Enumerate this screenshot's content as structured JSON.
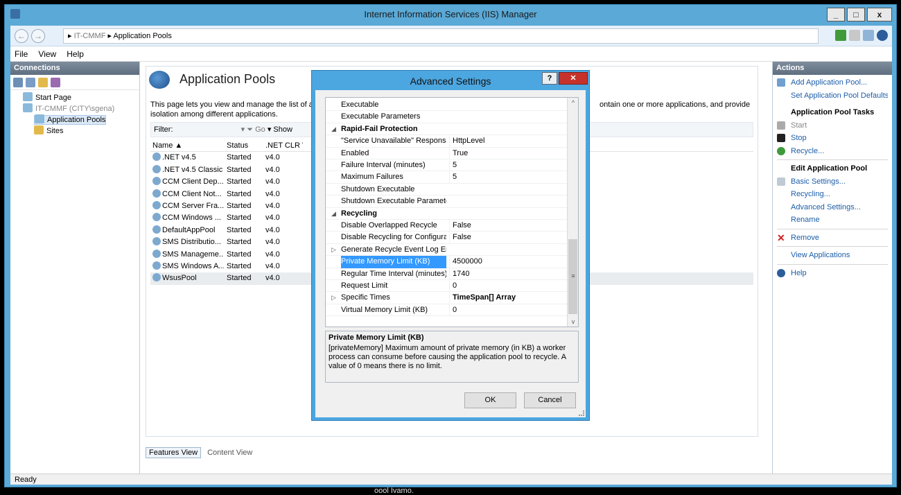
{
  "window": {
    "title": "Internet Information Services (IIS) Manager",
    "minimize": "_",
    "maximize": "□",
    "close": "x"
  },
  "address": {
    "back": "←",
    "forward": "→",
    "separator": "▸",
    "server": "IT-CMMF",
    "page": "Application Pools"
  },
  "menu": [
    "File",
    "View",
    "Help"
  ],
  "connections": {
    "header": "Connections",
    "tree": [
      {
        "label": "Start Page",
        "indent": 1
      },
      {
        "label": "IT-CMMF (CITY\\sgena)",
        "indent": 1
      },
      {
        "label": "Application Pools",
        "indent": 2,
        "selected": true
      },
      {
        "label": "Sites",
        "indent": 2
      }
    ]
  },
  "main": {
    "title": "Application Pools",
    "description": "This page lets you view and manage the list of app",
    "description2": "isolation among different applications.",
    "description_tail": "ontain one or more applications, and provide",
    "filter": {
      "label": "Filter:",
      "go": "Go",
      "show": "Show"
    },
    "columns": [
      "Name",
      "Status",
      ".NET CLR V..."
    ],
    "rows": [
      {
        "name": ".NET v4.5",
        "status": "Started",
        "clr": "v4.0"
      },
      {
        "name": ".NET v4.5 Classic",
        "status": "Started",
        "clr": "v4.0"
      },
      {
        "name": "CCM Client Dep...",
        "status": "Started",
        "clr": "v4.0"
      },
      {
        "name": "CCM Client Not...",
        "status": "Started",
        "clr": "v4.0"
      },
      {
        "name": "CCM Server Fra...",
        "status": "Started",
        "clr": "v4.0"
      },
      {
        "name": "CCM Windows ...",
        "status": "Started",
        "clr": "v4.0"
      },
      {
        "name": "DefaultAppPool",
        "status": "Started",
        "clr": "v4.0"
      },
      {
        "name": "SMS Distributio...",
        "status": "Started",
        "clr": "v4.0"
      },
      {
        "name": "SMS Manageme...",
        "status": "Started",
        "clr": "v4.0"
      },
      {
        "name": "SMS Windows A...",
        "status": "Started",
        "clr": "v4.0"
      },
      {
        "name": "WsusPool",
        "status": "Started",
        "clr": "v4.0",
        "selected": true
      }
    ],
    "tabs": {
      "features": "Features View",
      "content": "Content View"
    }
  },
  "actions": {
    "header": "Actions",
    "add_pool": "Add Application Pool...",
    "set_defaults": "Set Application Pool Defaults...",
    "tasks_header": "Application Pool Tasks",
    "start": "Start",
    "stop": "Stop",
    "recycle": "Recycle...",
    "edit_header": "Edit Application Pool",
    "basic": "Basic Settings...",
    "recycling": "Recycling...",
    "advanced": "Advanced Settings...",
    "rename": "Rename",
    "remove": "Remove",
    "view_apps": "View Applications",
    "help": "Help"
  },
  "status": {
    "text": "Ready"
  },
  "background_text": "oool Ivamo.",
  "dialog": {
    "title": "Advanced Settings",
    "help": "?",
    "close": "✕",
    "properties": [
      {
        "name": "Executable",
        "value": ""
      },
      {
        "name": "Executable Parameters",
        "value": ""
      },
      {
        "name": "Rapid-Fail Protection",
        "category": true,
        "expand": "◢"
      },
      {
        "name": "\"Service Unavailable\" Response Type",
        "value": "HttpLevel"
      },
      {
        "name": "Enabled",
        "value": "True"
      },
      {
        "name": "Failure Interval (minutes)",
        "value": "5"
      },
      {
        "name": "Maximum Failures",
        "value": "5"
      },
      {
        "name": "Shutdown Executable",
        "value": ""
      },
      {
        "name": "Shutdown Executable Parameters",
        "value": ""
      },
      {
        "name": "Recycling",
        "category": true,
        "expand": "◢"
      },
      {
        "name": "Disable Overlapped Recycle",
        "value": "False"
      },
      {
        "name": "Disable Recycling for Configuration Changes",
        "value": "False"
      },
      {
        "name": "Generate Recycle Event Log Entry",
        "value": "",
        "expand": "▷"
      },
      {
        "name": "Private Memory Limit (KB)",
        "value": "4500000",
        "selected": true
      },
      {
        "name": "Regular Time Interval (minutes)",
        "value": "1740"
      },
      {
        "name": "Request Limit",
        "value": "0"
      },
      {
        "name": "Specific Times",
        "value": "TimeSpan[] Array",
        "bold": true,
        "expand": "▷"
      },
      {
        "name": "Virtual Memory Limit (KB)",
        "value": "0"
      }
    ],
    "scroll": {
      "up": "^",
      "down": "v",
      "grip": "≡"
    },
    "description_title": "Private Memory Limit (KB)",
    "description_text": "[privateMemory] Maximum amount of private memory (in KB) a worker process can consume before causing the application pool to recycle.  A value of 0 means there is no limit.",
    "ok": "OK",
    "cancel": "Cancel"
  }
}
